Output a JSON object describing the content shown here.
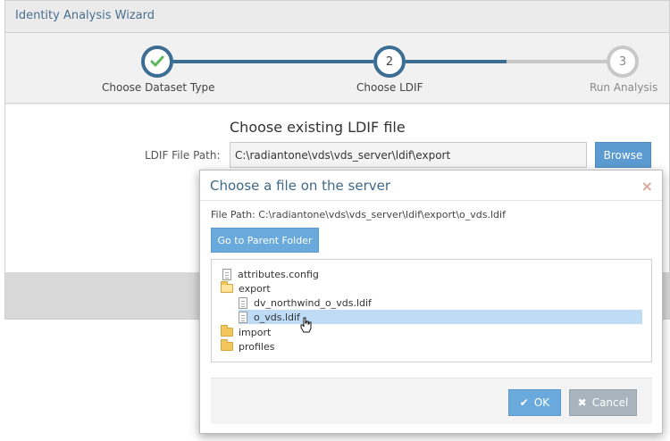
{
  "wizard": {
    "title": "Identity Analysis Wizard",
    "steps": [
      {
        "number": "",
        "label": "Choose Dataset Type",
        "status": "complete",
        "icon": "check-icon"
      },
      {
        "number": "2",
        "label": "Choose LDIF",
        "status": "active"
      },
      {
        "number": "3",
        "label": "Run Analysis",
        "status": "pending"
      }
    ],
    "section_title": "Choose existing LDIF file",
    "path_label": "LDIF File Path:",
    "path_value": "C:\\radiantone\\vds\\vds_server\\ldif\\export",
    "browse_label": "Browse"
  },
  "modal": {
    "title": "Choose a file on the server",
    "close_glyph": "×",
    "file_path_text": "File Path: C:\\radiantone\\vds\\vds_server\\ldif\\export\\o_vds.ldif",
    "parent_button": "Go to Parent Folder",
    "tree": [
      {
        "label": "attributes.config",
        "type": "file",
        "icon": "file-icon",
        "selected": false
      },
      {
        "label": "export",
        "type": "folder-open",
        "icon": "folder-open-icon",
        "selected": false
      },
      {
        "label": "dv_northwind_o_vds.ldif",
        "type": "file",
        "icon": "file-icon",
        "selected": false
      },
      {
        "label": "o_vds.ldif",
        "type": "file",
        "icon": "file-icon",
        "selected": true
      },
      {
        "label": "import",
        "type": "folder",
        "icon": "folder-icon",
        "selected": false
      },
      {
        "label": "profiles",
        "type": "folder",
        "icon": "folder-icon",
        "selected": false
      }
    ],
    "ok_label": "OK",
    "ok_glyph": "✔",
    "cancel_label": "Cancel",
    "cancel_glyph": "✖"
  },
  "colors": {
    "primary": "#5b9bd1",
    "step_active": "#3c6e94",
    "step_pending": "#c8c8c8",
    "check": "#5cb85c",
    "selection": "#bfdcf7"
  }
}
